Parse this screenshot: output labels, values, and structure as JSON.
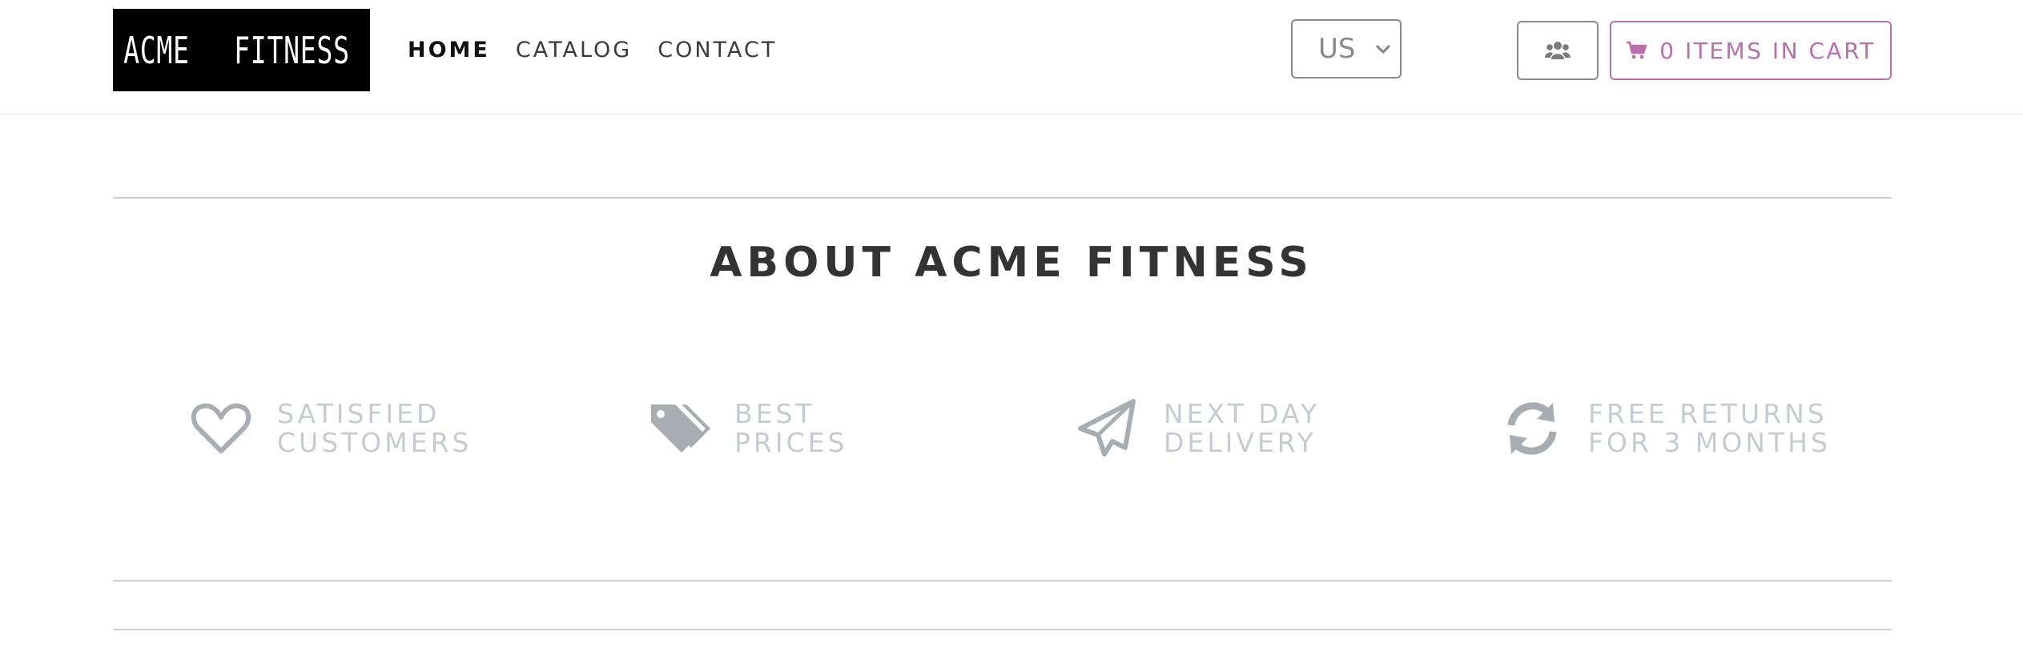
{
  "header": {
    "logo": {
      "left_text": "ACME",
      "right_text": "FITNESS"
    },
    "nav": [
      {
        "label": "HOME",
        "active": true
      },
      {
        "label": "CATALOG",
        "active": false
      },
      {
        "label": "CONTACT",
        "active": false
      }
    ],
    "region_select": {
      "selected": "US",
      "icon": "chevron-down-icon"
    },
    "user_button": {
      "icon": "users-icon"
    },
    "cart_button": {
      "icon": "cart-icon",
      "label": "0 ITEMS IN CART"
    }
  },
  "about": {
    "title": "ABOUT ACME FITNESS",
    "features": [
      {
        "icon": "heart-icon",
        "line1": "SATISFIED",
        "line2": "CUSTOMERS"
      },
      {
        "icon": "tags-icon",
        "line1": "BEST",
        "line2": "PRICES"
      },
      {
        "icon": "paper-plane-icon",
        "line1": "NEXT DAY",
        "line2": "DELIVERY"
      },
      {
        "icon": "refresh-icon",
        "line1": "FREE RETURNS",
        "line2": "FOR 3 MONTHS"
      }
    ]
  },
  "colors": {
    "accent": "#b86fae",
    "icon_gray": "#a8adb3",
    "feature_text": "#c6cbd1",
    "title": "#333333"
  }
}
